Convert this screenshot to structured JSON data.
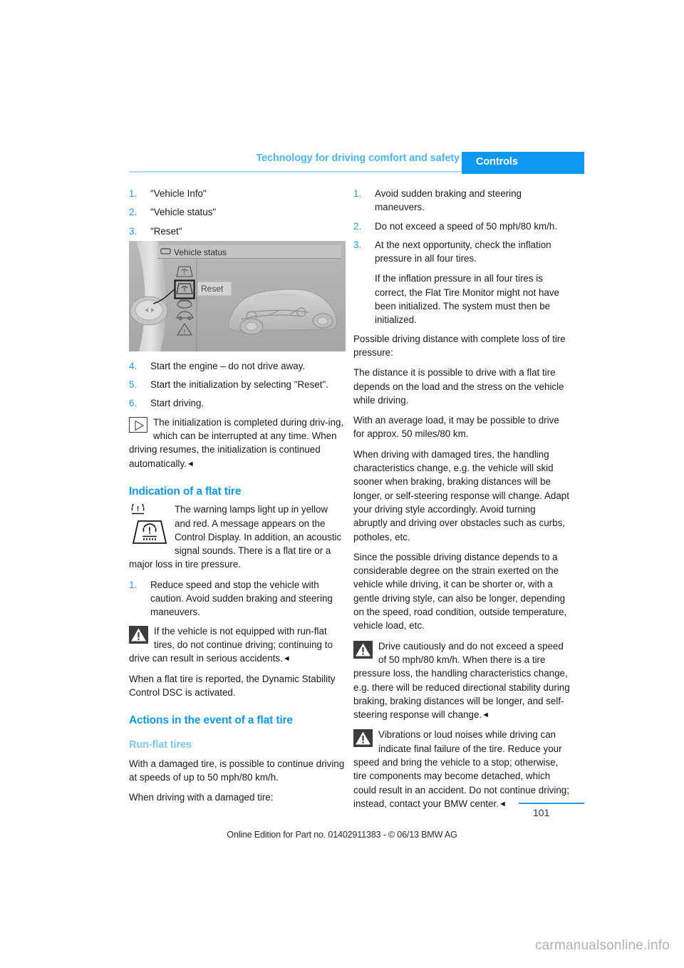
{
  "header": {
    "chapter": "Technology for driving comfort and safety",
    "section_badge": "Controls"
  },
  "left_column": {
    "menu_steps": [
      {
        "num": "1.",
        "text": "\"Vehicle Info\""
      },
      {
        "num": "2.",
        "text": "\"Vehicle status\""
      },
      {
        "num": "3.",
        "text": "\"Reset\""
      }
    ],
    "figure": {
      "title": "Vehicle status",
      "button_label": "Reset",
      "icon_names": [
        "tire-pressure-icon",
        "tire-pressure-reset-icon",
        "brake-icon",
        "car-icon",
        "warning-triangle-icon"
      ]
    },
    "init_steps": [
      {
        "num": "4.",
        "text": "Start the engine – do not drive away."
      },
      {
        "num": "5.",
        "text": "Start the initialization by selecting \"Reset\"."
      },
      {
        "num": "6.",
        "text": "Start driving."
      }
    ],
    "note_callout": {
      "icon": "note-icon",
      "indented": "The initialization is completed during driv-ing, which can be interrupted at any time.",
      "full": "When driving resumes, the initialization is continued automatically.",
      "end_mark": "◄"
    },
    "heading_indication": "Indication of a flat tire",
    "indication_callout": {
      "icon": "tire-pressure-warning-lamps-icon",
      "indented": "The warning lamps light up in yellow and red. A message appears on the Control Display. In addition, an acoustic signal sounds. There is a flat",
      "full": "tire or a major loss in tire pressure."
    },
    "reduce_step": {
      "num": "1.",
      "text": "Reduce speed and stop the vehicle with caution. Avoid sudden braking and steering maneuvers."
    },
    "warning_callout": {
      "icon": "warning-icon",
      "indented": "If the vehicle is not equipped with run-flat tires, do not continue driving; continuing",
      "full": "to drive can result in serious accidents.",
      "end_mark": "◄"
    },
    "dsc_para": "When a flat tire is reported, the Dynamic Stability Control DSC is activated.",
    "heading_actions": "Actions in the event of a flat tire",
    "subheading_runflat": "Run-flat tires",
    "runflat_para": "With a damaged tire, is possible to continue driving at speeds of up to 50 mph/80 km/h.",
    "runflat_intro": "When driving with a damaged tire:"
  },
  "right_column": {
    "driving_steps": [
      {
        "num": "1.",
        "text": "Avoid sudden braking and steering maneuvers.",
        "cont": ""
      },
      {
        "num": "2.",
        "text": "Do not exceed a speed of 50 mph/80 km/h.",
        "cont": ""
      },
      {
        "num": "3.",
        "text": "At the next opportunity, check the inflation pressure in all four tires.",
        "cont": "If the inflation pressure in all four tires is correct, the Flat Tire Monitor might not have been initialized. The system must then be initialized."
      }
    ],
    "distance_intro": "Possible driving distance with complete loss of tire pressure:",
    "distance_para": "The distance it is possible to drive with a flat tire depends on the load and the stress on the vehicle while driving.",
    "average_load_para": "With an average load, it may be possible to drive for approx. 50 miles/80 km.",
    "handling_para": "When driving with damaged tires, the handling characteristics change, e.g. the vehicle will skid sooner when braking, braking distances will be longer, or self-steering response will change. Adapt your driving style accordingly. Avoid turning abruptly and driving over obstacles such as curbs, potholes, etc.",
    "strain_para": "Since the possible driving distance depends to a considerable degree on the strain exerted on the vehicle while driving, it can be shorter or, with a gentle driving style, can also be longer, depending on the speed, road condition, outside temperature, vehicle load, etc.",
    "caution_callout": {
      "icon": "warning-icon",
      "indented": "Drive cautiously and do not exceed a speed of 50 mph/80 km/h.",
      "full": "When there is a tire pressure loss, the handling characteristics change, e.g. there will be reduced directional stability during braking, braking distances will be longer, and self-steering response will change.",
      "end_mark": "◄"
    },
    "vibration_callout": {
      "icon": "warning-icon",
      "indented": "Vibrations or loud noises while driving can indicate final failure of the tire. Reduce",
      "full": "your speed and bring the vehicle to a stop; otherwise, tire components may become detached, which could result in an accident. Do not continue driving; instead, contact your BMW center.",
      "end_mark": "◄"
    }
  },
  "footer": {
    "page_number": "101",
    "edition": "Online Edition for Part no. 01402911383 - © 06/13 BMW AG",
    "watermark": "carmanualsonline.info"
  },
  "colors": {
    "accent_blue": "#0d99f2",
    "light_blue": "#7cc6f2",
    "rule_blue": "#a8d8f5",
    "number_blue": "#1d9bf0"
  }
}
